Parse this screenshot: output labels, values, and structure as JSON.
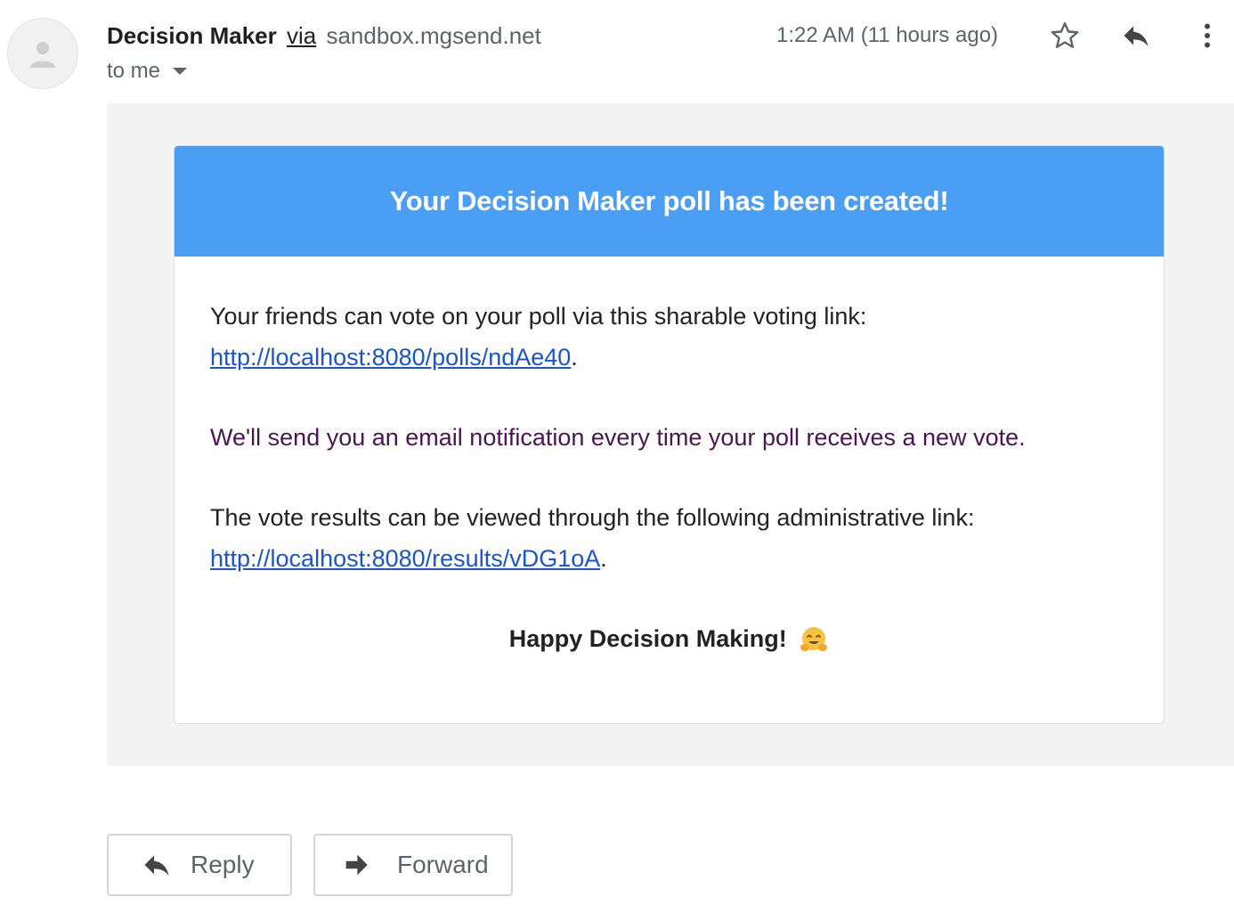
{
  "message": {
    "sender_name": "Decision Maker",
    "via_label": "via",
    "sender_domain": "sandbox.mgsend.net",
    "recipient_label": "to me",
    "timestamp": "1:22 AM (11 hours ago)"
  },
  "icons": {
    "avatar": "person-icon",
    "star": "star-icon",
    "reply": "reply-icon",
    "more": "more-vert-icon",
    "forward": "forward-icon",
    "emoji": "hugging-face-emoji"
  },
  "email_body": {
    "header_title": "Your Decision Maker poll has been created!",
    "vote_text": "Your friends can vote on your poll via this sharable voting link:",
    "vote_link": "http://localhost:8080/polls/ndAe40",
    "notification_text": "We'll send you an email notification every time your poll receives a new vote.",
    "results_text": "The vote results can be viewed through the following administrative link:",
    "results_link": "http://localhost:8080/results/vDG1oA",
    "period": ".",
    "signoff": "Happy Decision Making!"
  },
  "actions": {
    "reply_label": "Reply",
    "forward_label": "Forward"
  },
  "colors": {
    "header_bg": "#4a9ff5",
    "link": "#1a56c9",
    "notice_text": "#4a1552",
    "email_bg": "#f4f4f4"
  }
}
